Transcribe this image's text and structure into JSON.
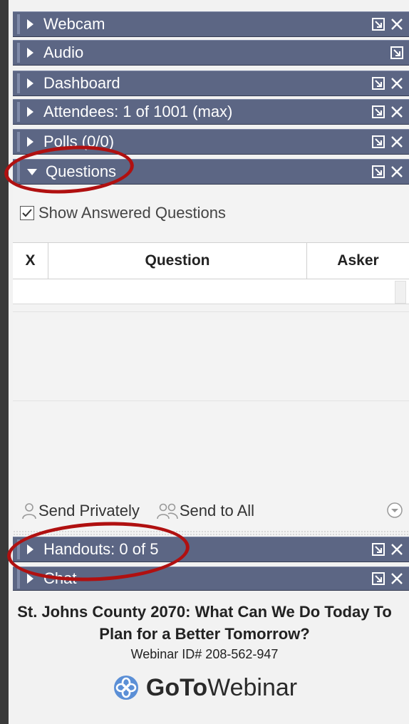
{
  "panels": [
    {
      "label": "Webcam",
      "popout": true,
      "close": true
    },
    {
      "label": "Audio",
      "popout": true,
      "close": false
    },
    {
      "label": "Dashboard",
      "popout": true,
      "close": true
    },
    {
      "label": "Attendees:  1 of 1001 (max)",
      "popout": true,
      "close": true
    },
    {
      "label": "Polls (0/0)",
      "popout": true,
      "close": true
    },
    {
      "label": "Questions",
      "popout": true,
      "close": true,
      "expanded": true
    },
    {
      "label": "Handouts: 0 of 5",
      "popout": true,
      "close": true
    },
    {
      "label": "Chat",
      "popout": true,
      "close": true
    }
  ],
  "questions": {
    "show_answered_label": "Show Answered Questions",
    "show_answered_checked": true,
    "columns": [
      "X",
      "Question",
      "Asker"
    ],
    "send_privately": "Send Privately",
    "send_to_all": "Send to All"
  },
  "footer": {
    "title": "St. Johns County 2070: What Can We Do Today To Plan for a Better Tomorrow?",
    "webinar_id": "Webinar ID# 208-562-947",
    "logo_goto": "GoTo",
    "logo_webinar": "Webinar"
  },
  "colors": {
    "panel_bar": "#5c6684",
    "annotation": "#b01010"
  },
  "icons": {
    "popout": "popout-icon",
    "close": "close-icon",
    "person": "person-icon",
    "people": "people-icon",
    "expand": "chevron-circle-icon",
    "logo": "gotowebinar-logo-icon"
  }
}
